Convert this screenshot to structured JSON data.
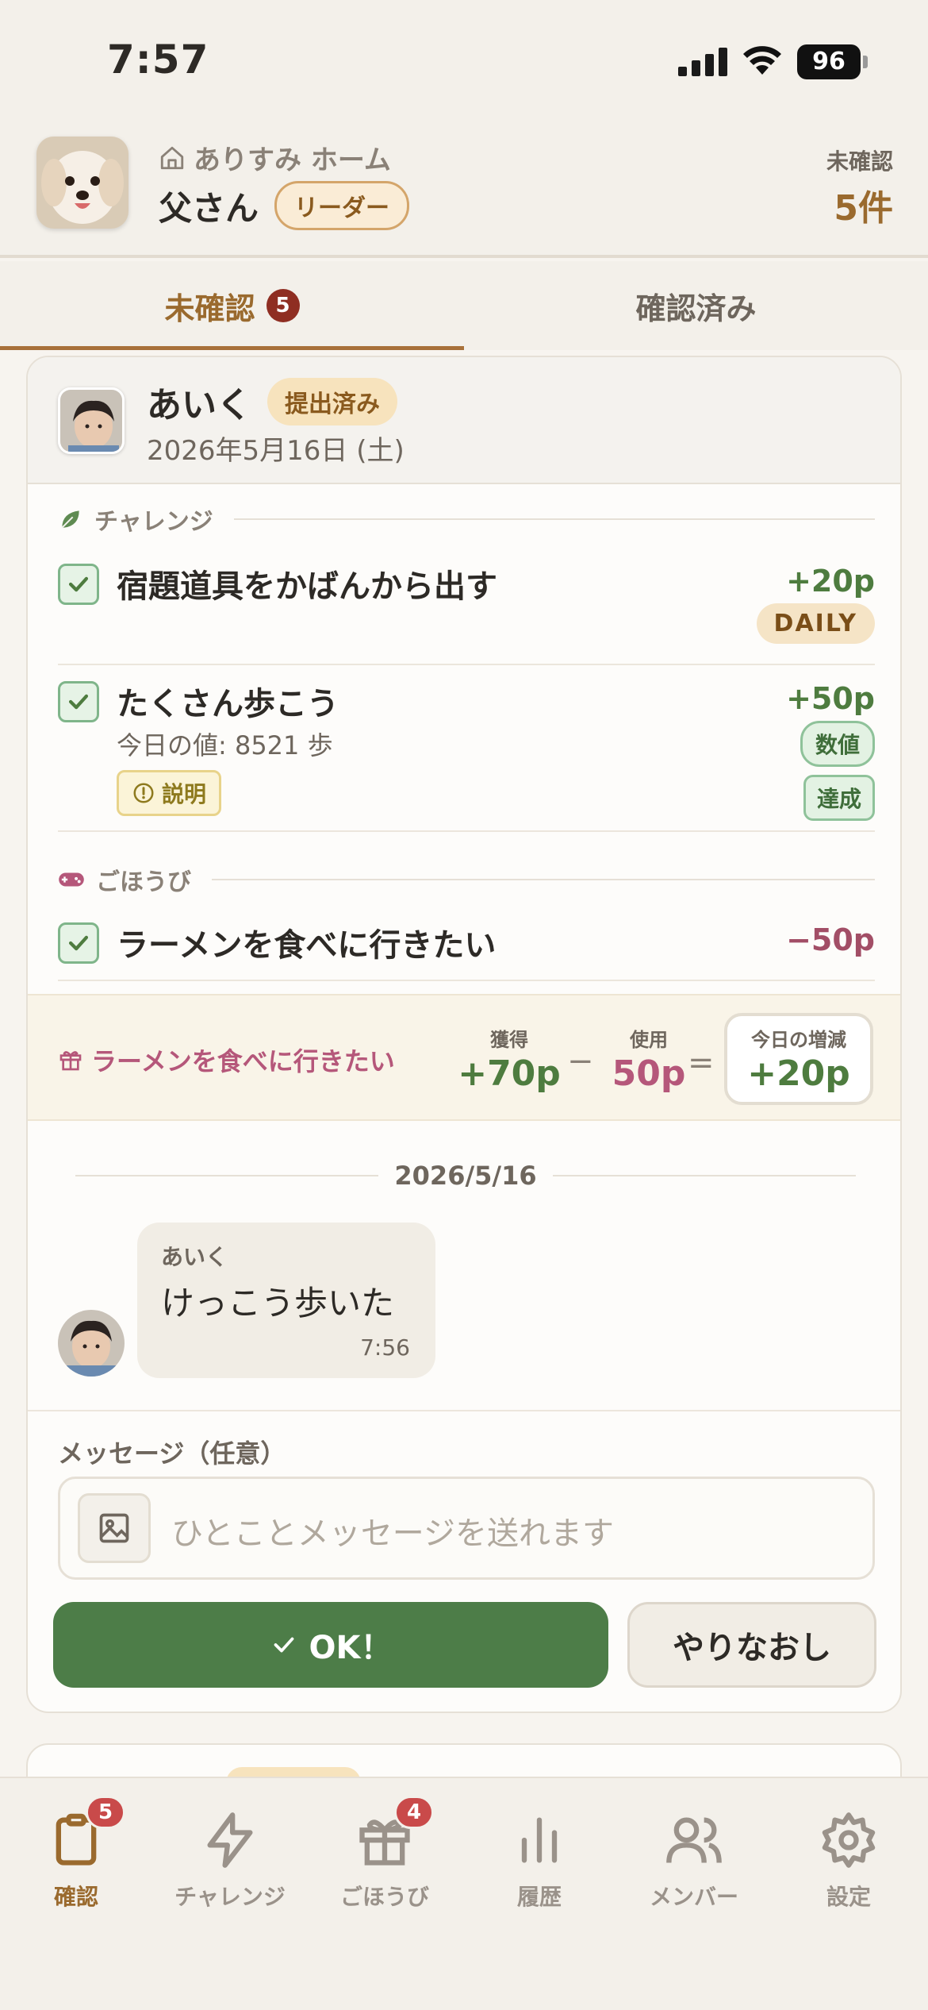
{
  "status": {
    "time": "7:57",
    "battery": "96"
  },
  "header": {
    "home_name": "ありすみ ホーム",
    "user_name": "父さん",
    "role_badge": "リーダー",
    "pending_label": "未確認",
    "pending_count": "5件"
  },
  "tabs": [
    {
      "label": "未確認",
      "badge": "5",
      "active": true
    },
    {
      "label": "確認済み",
      "active": false
    }
  ],
  "submission": {
    "kid_name": "あいく",
    "status_badge": "提出済み",
    "date": "2026年5月16日 (土)",
    "challenge_section": "チャレンジ",
    "challenges": [
      {
        "title": "宿題道具をかばんから出す",
        "points": "+20p",
        "badge": "DAILY"
      },
      {
        "title": "たくさん歩こう",
        "points": "+50p",
        "sub": "今日の値: 8521 歩",
        "tag": "数値",
        "tag2": "達成",
        "explain": "説明"
      }
    ],
    "reward_section": "ごほうび",
    "rewards": [
      {
        "title": "ラーメンを食べに行きたい",
        "points": "−50p"
      }
    ],
    "summary": {
      "reward_name": "ラーメンを食べに行きたい",
      "earned_label": "獲得",
      "earned": "+70p",
      "minus": "−",
      "used_label": "使用",
      "used": "50p",
      "equals": "=",
      "net_label": "今日の増減",
      "net": "+20p"
    },
    "chat": {
      "date": "2026/5/16",
      "sender": "あいく",
      "text": "けっこう歩いた",
      "time": "7:56"
    },
    "message": {
      "label": "メッセージ（任意）",
      "placeholder": "ひとことメッセージを送れます"
    },
    "ok_label": "OK！",
    "redo_label": "やりなおし"
  },
  "nav": [
    {
      "label": "確認",
      "badge": "5",
      "icon": "clipboard-icon",
      "active": true
    },
    {
      "label": "チャレンジ",
      "icon": "lightning-icon"
    },
    {
      "label": "ごほうび",
      "badge": "4",
      "icon": "gift-icon"
    },
    {
      "label": "履歴",
      "icon": "bar-chart-icon"
    },
    {
      "label": "メンバー",
      "icon": "users-icon"
    },
    {
      "label": "設定",
      "icon": "gear-icon"
    }
  ],
  "colors": {
    "accent": "#9a6a2e",
    "positive": "#4e7c3f",
    "negative": "#a24e66",
    "ok_button": "#4d7d48",
    "badge_red": "#c94a4a"
  }
}
